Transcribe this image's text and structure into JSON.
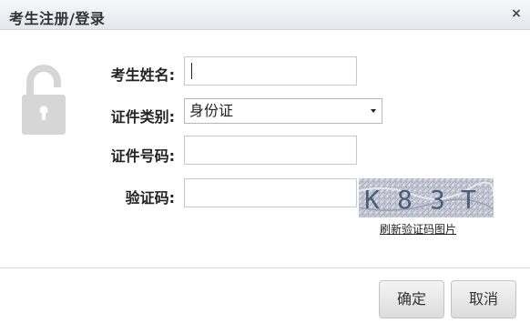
{
  "dialog": {
    "title": "考生注册/登录",
    "close_glyph": "×"
  },
  "form": {
    "name_label": "考生姓名:",
    "name_value": "",
    "id_type_label": "证件类别:",
    "id_type_selected": "身份证",
    "id_number_label": "证件号码:",
    "id_number_value": "",
    "captcha_label": "验证码:",
    "captcha_value": "",
    "captcha_text": [
      "K",
      "8",
      "3",
      "T"
    ],
    "refresh_captcha_link": "刷新验证码图片"
  },
  "buttons": {
    "confirm_label": "确定",
    "cancel_label": "取消"
  },
  "icons": {
    "lock": "lock-icon",
    "close": "close-icon",
    "dropdown": "chevron-down-icon"
  },
  "colors": {
    "title_bar_top": "#f7f8fa",
    "title_bar_bottom": "#e3e7ee",
    "lock_gray": "#d6d6d6",
    "captcha_text": "#4a5d7c"
  }
}
